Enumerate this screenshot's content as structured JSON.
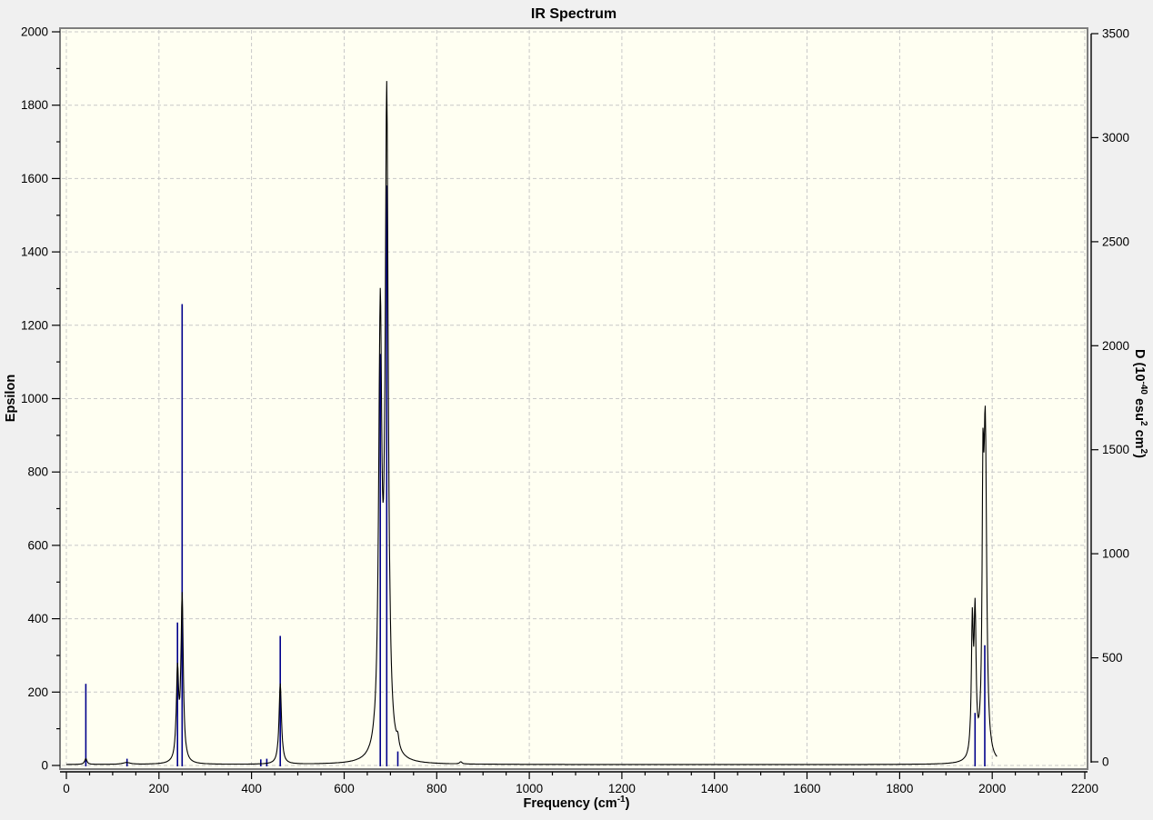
{
  "window": {
    "background": "#f0f0f0"
  },
  "chart_data": {
    "type": "line",
    "title": "IR Spectrum",
    "colors": {
      "plot_background": "#fffff2",
      "grid": "#c8c8c8",
      "border": "#7d7d7d",
      "curve": "#000000",
      "sticks": "#00008b",
      "axis": "#000000"
    },
    "x_axis": {
      "label_segments": [
        {
          "t": "Frequency (cm"
        },
        {
          "t": "-1",
          "sup": true
        },
        {
          "t": ")"
        }
      ],
      "min": 0,
      "max": 2200,
      "major_step": 200,
      "minor_step": 50
    },
    "y_left": {
      "label_segments": [
        {
          "t": "Epsilon"
        }
      ],
      "min": 0,
      "max": 2000,
      "major_step": 200,
      "minor_step": 100
    },
    "y_right": {
      "label_segments": [
        {
          "t": "D (10"
        },
        {
          "t": "-40",
          "sup": true
        },
        {
          "t": " esu"
        },
        {
          "t": "2",
          "sup": true
        },
        {
          "t": " cm"
        },
        {
          "t": "2",
          "sup": true
        },
        {
          "t": ")"
        }
      ],
      "min": 0,
      "max": 3500,
      "major_step": 500
    },
    "legend": "none",
    "grid": "dashed, at major ticks of x and left y axes",
    "curve_series": {
      "name": "epsilon-spectrum",
      "units": "Epsilon (left axis)",
      "model": "lorentzian_sum",
      "baseline": 2.5,
      "domain": [
        0,
        2010
      ],
      "peaks_freq_height_hwhm": [
        [
          42,
          16,
          3
        ],
        [
          130,
          5,
          10
        ],
        [
          240,
          240,
          3
        ],
        [
          250,
          450,
          3
        ],
        [
          462,
          220,
          3.2
        ],
        [
          678,
          1165,
          4
        ],
        [
          692,
          1775,
          4
        ],
        [
          716,
          28,
          3
        ],
        [
          852,
          6,
          3
        ],
        [
          1957,
          355,
          2.5
        ],
        [
          1963,
          370,
          2.5
        ],
        [
          1980,
          620,
          2.2
        ],
        [
          1985,
          870,
          3.5
        ]
      ]
    },
    "stick_series": {
      "name": "dipole-strength-sticks",
      "units": "D, 10^-40 esu^2 cm^2 (right axis)",
      "points_freq_D": [
        [
          42,
          375
        ],
        [
          131,
          15
        ],
        [
          240,
          670
        ],
        [
          250,
          2200
        ],
        [
          420,
          12
        ],
        [
          433,
          15
        ],
        [
          462,
          605
        ],
        [
          678,
          1960
        ],
        [
          692,
          2770
        ],
        [
          716,
          50
        ],
        [
          1963,
          235
        ],
        [
          1984,
          560
        ]
      ]
    }
  }
}
